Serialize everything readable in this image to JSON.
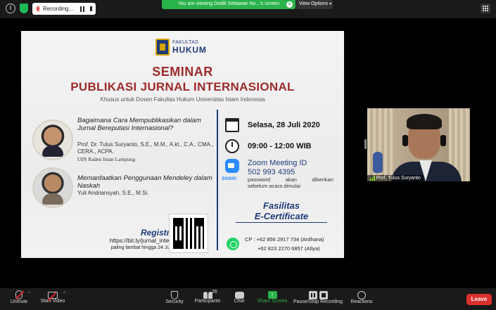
{
  "topbar": {
    "recording_label": "Recording...",
    "viewing_banner": "You are viewing Dodik Setiawan Nu...'s screen",
    "view_options_label": "View Options"
  },
  "slide": {
    "faculty_small": "FAKULTAS",
    "faculty_big": "HUKUM",
    "title_line1": "SEMINAR",
    "title_line2": "PUBLIKASI JURNAL INTERNASIONAL",
    "subtitle": "Khusus untuk Dosen Fakultas Hukum Universitas Islam Indonesia",
    "talk1": {
      "question": "Bagaimana Cara Mempublikasikan dalam Jurnal Bereputasi Internasional?",
      "speaker": "Prof. Dr. Tulus Suryanto, S.E., M.M., A.kt., C.A., CMA., CERA., ACPA.",
      "institution": "UIN Raden Intan Lampung"
    },
    "talk2": {
      "question": "Memanfaatkan Penggunaan Mendeley dalam Naskah",
      "speaker": "Yuli Andriansyah, S.E., M.Si."
    },
    "registration": {
      "label": "Registrasi:",
      "url": "https://bit.ly/jurnal_inter2020",
      "deadline": "paling lambat hingga 24 Juli 2020"
    },
    "event": {
      "date": "Selasa, 28 Juli 2020",
      "time": "09:00 - 12:00 WIB",
      "zoom_label": "Zoom Meeting ID",
      "zoom_id": "502 993 4395",
      "zoom_word": "zoom",
      "password_word1": "password",
      "password_word2": "akan",
      "password_word3": "diberikan",
      "password_line2": "sebelum acara dimulai"
    },
    "facility_line1": "Fasilitas",
    "facility_line2": "E-Certificate",
    "contact1": "CP : +62 856 2917 734 (Ardhana)",
    "contact2": "+62 823 2270 6857 (Afiya)"
  },
  "participant": {
    "name": "Prof. Tulus Suryanto"
  },
  "toolbar": {
    "unmute": "Unmute",
    "start_video": "Start Video",
    "security": "Security",
    "participants": "Participants",
    "participants_count": "26",
    "chat": "Chat",
    "share_screen": "Share Screen",
    "pause_stop_recording": "Pause/Stop Recording",
    "reactions": "Reactions",
    "leave": "Leave"
  },
  "colors": {
    "title_red": "#9e2a2b",
    "navy": "#1f3a7a",
    "zoom_blue": "#2d8cff",
    "share_green": "#2ab34b",
    "leave_red": "#d9302c"
  }
}
